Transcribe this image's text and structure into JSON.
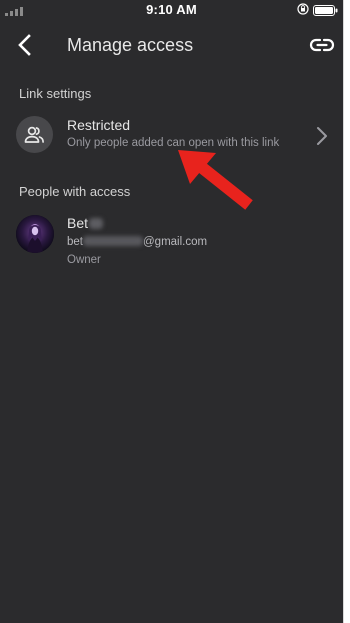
{
  "status_bar": {
    "time": "9:10 AM"
  },
  "header": {
    "title": "Manage access",
    "back_icon": "chevron-left-icon",
    "link_icon": "link-icon"
  },
  "link_settings": {
    "section_label": "Link settings",
    "access_level": "Restricted",
    "description": "Only people added can open with this link",
    "icon": "people-icon"
  },
  "people_with_access": {
    "section_label": "People with access",
    "people": [
      {
        "name_visible": "Bet",
        "email_prefix": "bet",
        "email_domain": "@gmail.com",
        "role": "Owner"
      }
    ]
  },
  "colors": {
    "background": "#2b2b2d",
    "annotation_arrow": "#e8231d",
    "primary_text": "#e6e6e6",
    "secondary_text": "#9a9aa0"
  }
}
